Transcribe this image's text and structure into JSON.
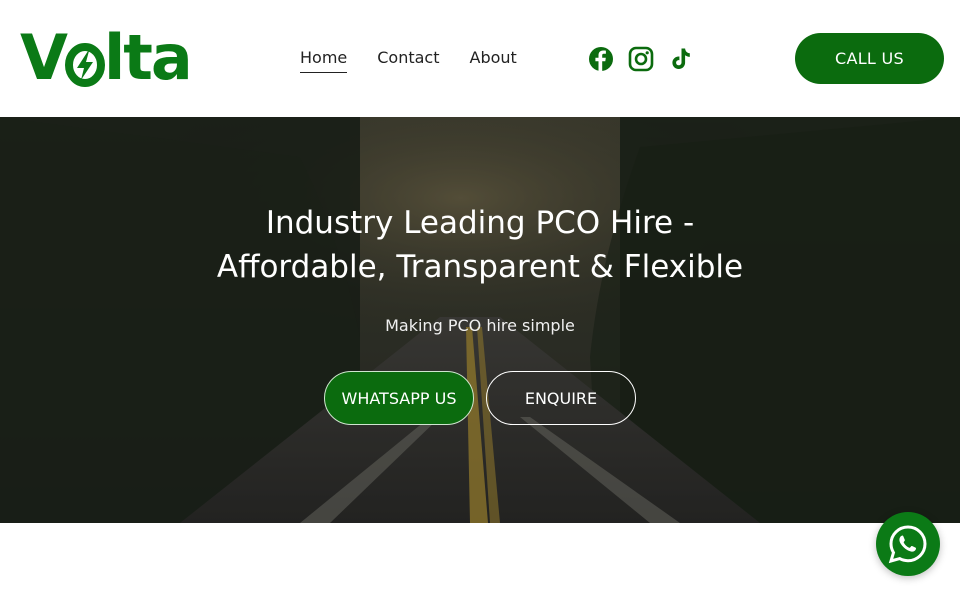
{
  "brand": {
    "logo_text": "Volta",
    "color": "#0b7a16"
  },
  "nav": {
    "items": [
      {
        "label": "Home",
        "active": true
      },
      {
        "label": "Contact",
        "active": false
      },
      {
        "label": "About",
        "active": false
      }
    ]
  },
  "social": {
    "icons": [
      "facebook-icon",
      "instagram-icon",
      "tiktok-icon"
    ]
  },
  "header": {
    "call_label": "CALL US"
  },
  "hero": {
    "title_line1": "Industry Leading PCO Hire -",
    "title_line2": "Affordable, Transparent & Flexible",
    "subtitle": "Making PCO hire simple",
    "whatsapp_label": "WHATSAPP US",
    "enquire_label": "ENQUIRE"
  },
  "colors": {
    "accent": "#0b6b0e",
    "text": "#222222"
  }
}
